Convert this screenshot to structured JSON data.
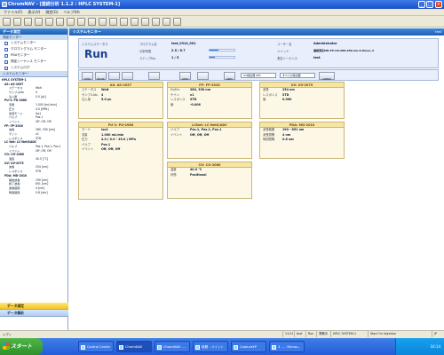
{
  "window": {
    "title": "ChromNAV - [連続分析 1.1.2 : HPLC SYSTEM-1]"
  },
  "menu": [
    "ファイル(F)",
    "表示(V)",
    "測定(G)",
    "ヘルプ(H)"
  ],
  "left_panel": {
    "header": "データ測定",
    "sub_header": "測定モニター",
    "nav_items": [
      "システムモニター",
      "クロマトグラム モニター",
      "PDAモニター",
      "測定シーケンス モニター",
      "システムログ"
    ],
    "tree_header": "システムモニター",
    "tree": [
      [
        "HPLC SYSTEM-1",
        ""
      ],
      [
        "AS: AS-2057",
        ""
      ],
      [
        "ステータス",
        "Wait"
      ],
      [
        "サンプルNo.",
        "4"
      ],
      [
        "注入量",
        "5.0 [µL]"
      ],
      [
        "PU-1: PU-2080",
        ""
      ],
      [
        "流量",
        "1.000 [mL/min]"
      ],
      [
        "圧力",
        "4.0 [MPa]"
      ],
      [
        "送液モード",
        "Iso1"
      ],
      [
        "バルブ",
        "Pos.1"
      ],
      [
        "イベント",
        "Off, Off, Off"
      ],
      [
        "FP: FP-2020",
        ""
      ],
      [
        "波長",
        "280, 330 [nm]"
      ],
      [
        "ゲイン",
        "x1"
      ],
      [
        "レスポンス",
        "STD"
      ],
      [
        "LC Net: LC-NetII/ADC",
        ""
      ],
      [
        "バルブ",
        "Pos.1, Pos.1, Pos.1"
      ],
      [
        "イベント",
        "Off, Off, Off"
      ],
      [
        "CO: CO-2060",
        ""
      ],
      [
        "温度",
        "40.0 [°C]"
      ],
      [
        "UV: UV-2075",
        ""
      ],
      [
        "波長",
        "254 [nm]"
      ],
      [
        "レスポンス",
        "STD"
      ],
      [
        "PDA: MD-2010",
        ""
      ],
      [
        "開始波長",
        "190 [nm]"
      ],
      [
        "終了波長",
        "651 [nm]"
      ],
      [
        "波長間隔",
        "4 [nm]"
      ],
      [
        "時間間隔",
        "0.8 [sec]"
      ]
    ],
    "bottom_buttons": [
      "データ測定",
      "データ解析"
    ]
  },
  "monitor": {
    "title": "システムモニター",
    "title_right": "test",
    "status": "Run",
    "system_status_label": "システムステータス",
    "method_label": "プログラム名",
    "method_value": "test_0314_001",
    "time_label": "分析時間",
    "time_value": "2.5 / 6.7",
    "step_label": "ステップNo.",
    "step_value": "1 / 5",
    "progress": [
      0.37,
      0.2
    ],
    "user_label": "ユーザー名",
    "user_value": "Administrator",
    "method2_label": "メソッド",
    "method2_value": "連続測定MD-FP-UV-200-650-nm-0.8nsec-4",
    "sequence_label": "測定シーケンス",
    "sequence_value": "test",
    "controls": [
      "STOP",
      "PAUSE",
      "",
      "",
      "",
      "STOP",
      "",
      "SPEC"
    ],
    "detector_select": "UV検出器 SPC",
    "channel_select": "すべての検出器",
    "autozero": "A/ZERO"
  },
  "cards": [
    {
      "title": "AS: AS-2057",
      "rows": [
        [
          "ステータス",
          "Wait"
        ],
        [
          "サンプルNo.",
          "4"
        ],
        [
          "注入量",
          "5.0 µL"
        ]
      ]
    },
    {
      "title": "FP: FP-2020",
      "rows": [
        [
          "Ex/Em",
          "280, 330 nm"
        ],
        [
          "ゲイン",
          "x1"
        ],
        [
          "レスポンス",
          "STD"
        ],
        [
          "値",
          "-0.006"
        ]
      ]
    },
    {
      "title": "UV: UV-2075",
      "rows": [
        [
          "波長",
          "254 nm"
        ],
        [
          "レスポンス",
          "STD"
        ],
        [
          "値",
          "0.000"
        ]
      ]
    },
    {
      "title": "PU-1: PU-2080",
      "rows": [
        [
          "モード",
          "Iso1"
        ],
        [
          "流量",
          "1.000 mL/min"
        ],
        [
          "圧力",
          "4.0 ( 0.0 - 25.0 ) MPa"
        ],
        [
          "バルブ",
          "Pos.1"
        ],
        [
          "イベント",
          "Off, Off, Off"
        ]
      ]
    },
    {
      "title": "LCNet: LC-NetII/ADC",
      "rows": [
        [
          "バルブ",
          "Pos.1, Pos.1, Pos.1"
        ],
        [
          "イベント",
          "Off, Off, Off"
        ]
      ]
    },
    {
      "title": "PDA: MD-2010",
      "rows": [
        [
          "波長範囲",
          "190 - 651 nm"
        ],
        [
          "波長間隔",
          "4 nm"
        ],
        [
          "時間間隔",
          "0.8 sec"
        ]
      ]
    },
    {
      "title": "CO: CO-2060",
      "rows": [
        [
          "温度",
          "40.0 °C"
        ],
        [
          "状態",
          "Positional"
        ]
      ]
    }
  ],
  "statusbar": {
    "left": "レディ",
    "cells": [
      "11:21",
      "test",
      "Run",
      "準備中",
      "HPLC SYSTEM-1",
      "Start On Injection",
      "JP"
    ]
  },
  "taskbar": {
    "start": "スタート",
    "tasks": [
      "Control Center",
      "ChromNAV",
      "ChromNAV -...",
      "無題 - ペイント",
      "CaptureXP",
      "3 ... - Micros..."
    ],
    "clock": "10:14"
  }
}
